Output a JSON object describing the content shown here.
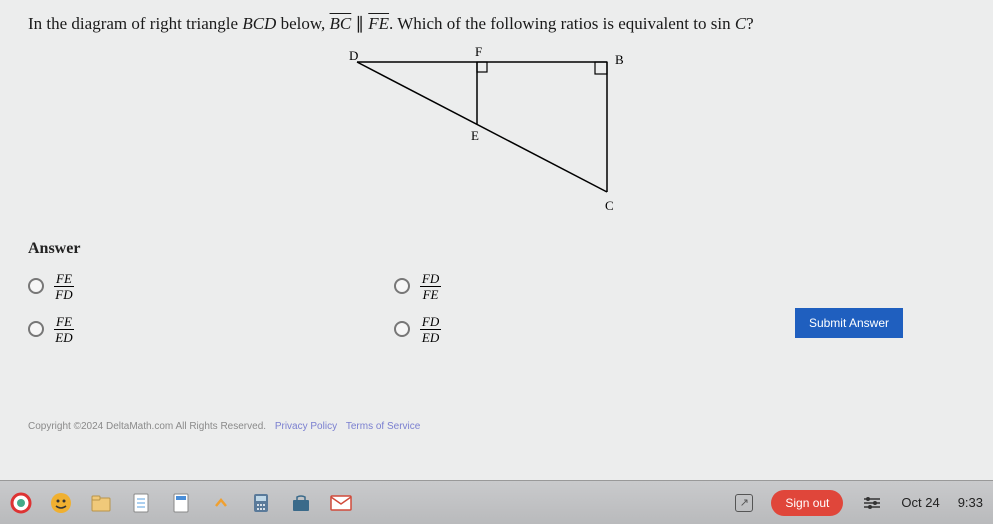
{
  "question": {
    "prefix": "In the diagram of right triangle ",
    "triangle": "BCD",
    "mid1": " below, ",
    "seg1": "BC",
    "parallel": " ∥ ",
    "seg2": "FE",
    "mid2": ". Which of the following ratios is equivalent to sin ",
    "angle": "C",
    "suffix": "?"
  },
  "diagram": {
    "labels": {
      "D": "D",
      "F": "F",
      "B": "B",
      "E": "E",
      "C": "C"
    }
  },
  "answer_header": "Answer",
  "options": {
    "a": {
      "num": "FE",
      "den": "FD"
    },
    "b": {
      "num": "FD",
      "den": "FE"
    },
    "c": {
      "num": "FE",
      "den": "ED"
    },
    "d": {
      "num": "FD",
      "den": "ED"
    }
  },
  "submit_label": "Submit Answer",
  "footer": {
    "copyright": "Copyright ©2024 DeltaMath.com All Rights Reserved.",
    "privacy": "Privacy Policy",
    "terms": "Terms of Service"
  },
  "taskbar": {
    "signout": "Sign out",
    "date": "Oct 24",
    "time": "9:33"
  }
}
